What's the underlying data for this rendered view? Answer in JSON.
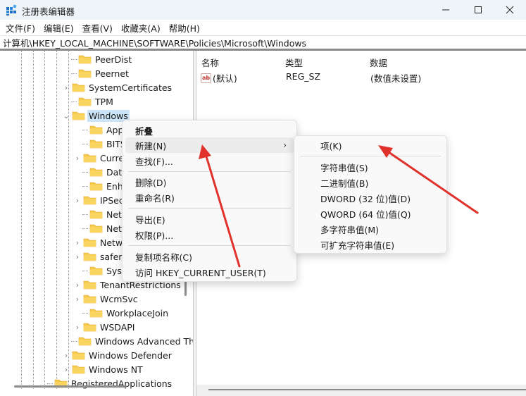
{
  "window": {
    "title": "注册表编辑器",
    "controls": {
      "minimize": "—",
      "maximize": "☐",
      "close": "✕"
    }
  },
  "menubar": {
    "items": [
      {
        "label": "文件(F)"
      },
      {
        "label": "编辑(E)"
      },
      {
        "label": "查看(V)"
      },
      {
        "label": "收藏夹(A)"
      },
      {
        "label": "帮助(H)"
      }
    ]
  },
  "address": {
    "path": "计算机\\HKEY_LOCAL_MACHINE\\SOFTWARE\\Policies\\Microsoft\\Windows"
  },
  "tree": {
    "items": [
      {
        "label": "PeerDist",
        "expander": ""
      },
      {
        "label": "Peernet",
        "expander": ""
      },
      {
        "label": "SystemCertificates",
        "expander": "›"
      },
      {
        "label": "TPM",
        "expander": ""
      },
      {
        "label": "Windows",
        "expander": "⌄",
        "selected": true
      },
      {
        "label": "AppPrivacy",
        "expander": ""
      },
      {
        "label": "BITS",
        "expander": ""
      },
      {
        "label": "CurrentVersion",
        "expander": "›"
      },
      {
        "label": "DataCollection",
        "expander": ""
      },
      {
        "label": "EnhancedStorageDevices",
        "expander": ""
      },
      {
        "label": "IPSec",
        "expander": "›"
      },
      {
        "label": "Network Connections",
        "expander": ""
      },
      {
        "label": "NetworkConnectivityStatusIndicator",
        "expander": ""
      },
      {
        "label": "NetworkProvider",
        "expander": "›"
      },
      {
        "label": "safer",
        "expander": "›"
      },
      {
        "label": "System",
        "expander": ""
      },
      {
        "label": "TenantRestrictions",
        "expander": "›"
      },
      {
        "label": "WcmSvc",
        "expander": "›"
      },
      {
        "label": "WorkplaceJoin",
        "expander": ""
      },
      {
        "label": "WSDAPI",
        "expander": "›"
      },
      {
        "label": "Windows Advanced Th",
        "expander": ""
      },
      {
        "label": "Windows Defender",
        "expander": "›"
      },
      {
        "label": "Windows NT",
        "expander": "›"
      },
      {
        "label": "RegisteredApplications",
        "expander": ""
      }
    ]
  },
  "values": {
    "columns": {
      "name": "名称",
      "type": "类型",
      "data": "数据"
    },
    "rows": [
      {
        "icon": "ab",
        "name": "(默认)",
        "type": "REG_SZ",
        "data": "(数值未设置)"
      }
    ]
  },
  "context_menu": {
    "items": [
      {
        "label": "折叠",
        "bold": true
      },
      {
        "label": "新建(N)",
        "submenu_arrow": "›",
        "highlighted": true
      },
      {
        "label": "查找(F)..."
      },
      {
        "label": "删除(D)"
      },
      {
        "label": "重命名(R)"
      },
      {
        "label": "导出(E)"
      },
      {
        "label": "权限(P)..."
      },
      {
        "label": "复制项名称(C)"
      },
      {
        "label": "访问 HKEY_CURRENT_USER(T)"
      }
    ]
  },
  "submenu": {
    "items": [
      {
        "label": "项(K)"
      },
      {
        "label": "字符串值(S)"
      },
      {
        "label": "二进制值(B)"
      },
      {
        "label": "DWORD (32 位)值(D)"
      },
      {
        "label": "QWORD (64 位)值(Q)"
      },
      {
        "label": "多字符串值(M)"
      },
      {
        "label": "可扩充字符串值(E)"
      }
    ]
  },
  "colors": {
    "titlebar": "#eff4f9",
    "selection": "#cce4f7",
    "folder": "#f6c94b",
    "annotation_arrow": "#e0312a"
  }
}
